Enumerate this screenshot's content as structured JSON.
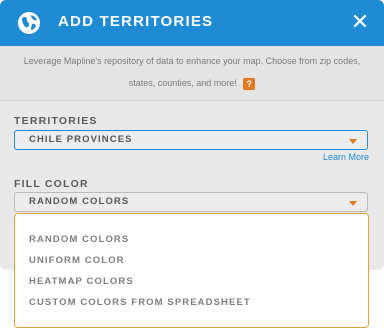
{
  "header": {
    "title": "ADD TERRITORIES",
    "icon": "globe-icon",
    "close_glyph": "✕",
    "color": "#1e8bd4"
  },
  "intro": {
    "line1": "Leverage Mapline's repository of data to enhance your map. Choose from zip codes,",
    "line2": "states, counties, and more!",
    "help_label": "?"
  },
  "territories": {
    "label": "TERRITORIES",
    "selected": "CHILE PROVINCES",
    "learn_more": "Learn More"
  },
  "fill_color": {
    "label": "FILL COLOR",
    "selected": "RANDOM COLORS",
    "options": [
      "RANDOM COLORS",
      "UNIFORM COLOR",
      "HEATMAP COLORS",
      "CUSTOM COLORS FROM SPREADSHEET"
    ]
  },
  "colors": {
    "accent": "#1e8bd4",
    "caret": "#e0791f",
    "menu_border": "#e0a23a"
  }
}
